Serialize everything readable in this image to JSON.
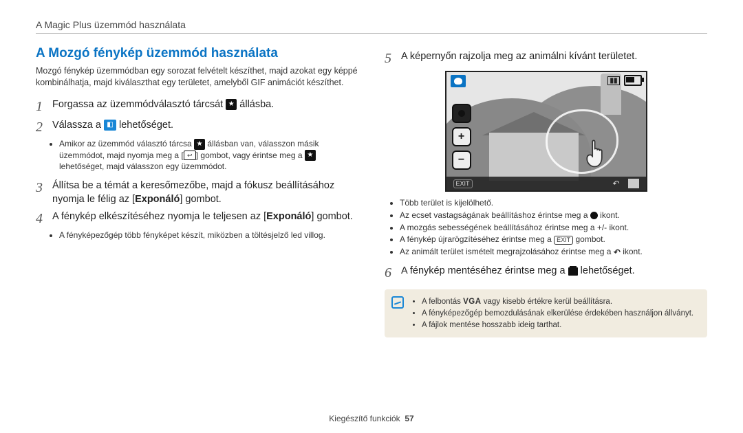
{
  "breadcrumb": "A Magic Plus üzemmód használata",
  "title": "A Mozgó fénykép üzemmód használata",
  "intro": "Mozgó fénykép üzemmódban egy sorozat felvételt készíthet, majd azokat egy képpé kombinálhatja, majd kiválaszthat egy területet, amelyből GIF animációt készíthet.",
  "steps": {
    "s1a": "Forgassa az üzemmódválasztó tárcsát ",
    "s1b": " állásba.",
    "s2a": "Válassza a ",
    "s2b": " lehetőséget.",
    "s2_b1": "Amikor az üzemmód választó tárcsa ",
    "s2_b1m": " állásban van, válasszon másik üzemmódot, majd nyomja meg a [",
    "s2_b1m2": "] gombot, vagy érintse meg a ",
    "s2_b1e": " lehetőséget, majd válasszon egy üzemmódot.",
    "s3a": "Állítsa be a témát a keresőmezőbe, majd a fókusz beállításához nyomja le félig az [",
    "s3b": "] gombot.",
    "s3_bold": "Exponáló",
    "s4a": "A fénykép elkészítéséhez nyomja le teljesen az [",
    "s4b": "] gombot.",
    "s4_bold": "Exponáló",
    "s4_b1": "A fényképezőgép több fényképet készít, miközben a töltésjelző led villog.",
    "s5": "A képernyőn rajzolja meg az animálni kívánt területet.",
    "s5_b1": "Több terület is kijelölhető.",
    "s5_b2a": "Az ecset vastagságának beállításhoz érintse meg a ",
    "s5_b2b": " ikont.",
    "s5_b3": "A mozgás sebességének beállításához érintse meg a +/- ikont.",
    "s5_b4a": "A fénykép újrarögzítéséhez érintse meg a ",
    "s5_b4b": " gombot.",
    "s5_b5a": "Az animált terület ismételt megrajzolásához érintse meg a ",
    "s5_b5b": " ikont.",
    "s6a": "A fénykép mentéséhez érintse meg a ",
    "s6b": " lehetőséget.",
    "note1a": "A felbontás ",
    "note1b": " vagy kisebb értékre kerül beállításra.",
    "note2": "A fényképezőgép bemozdulásának elkerülése érdekében használjon állványt.",
    "note3": "A fájlok mentése hosszabb ideig tarthat.",
    "vga": "VGA",
    "exit": "EXIT",
    "plus": "+",
    "minus": "−"
  },
  "footer_label": "Kiegészítő funkciók",
  "footer_page": "57"
}
